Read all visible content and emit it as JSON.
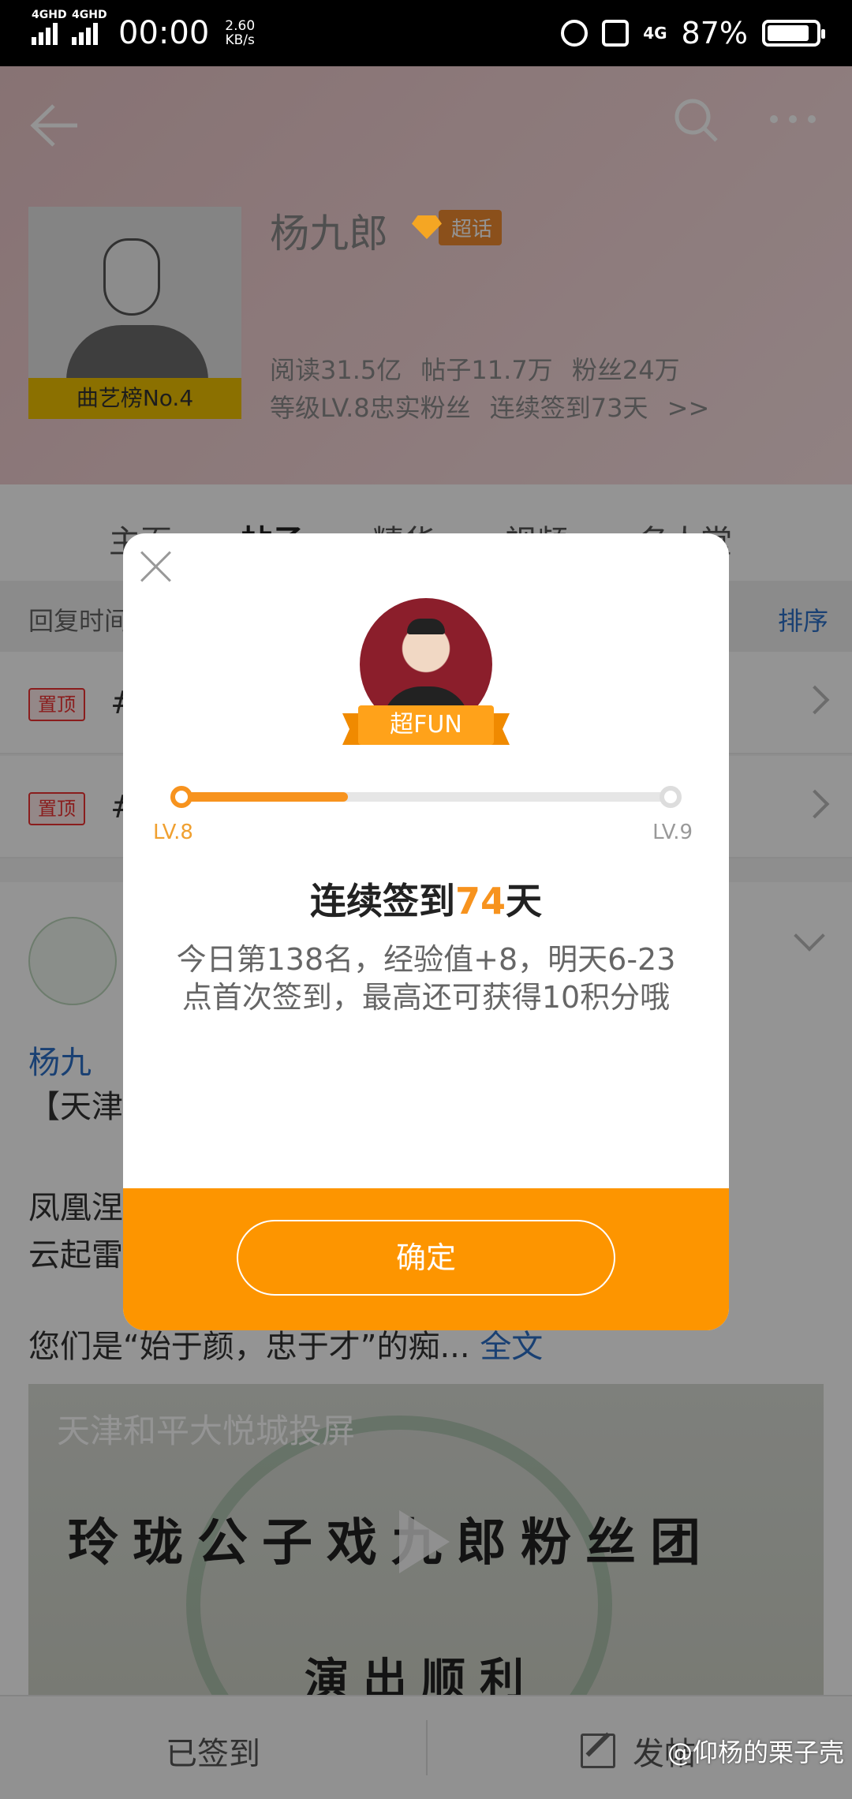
{
  "status_bar": {
    "network1": "4GHD",
    "network2": "4GHD",
    "time": "00:00",
    "speed_value": "2.60",
    "speed_unit": "KB/s",
    "network3": "4G",
    "battery": "87%",
    "battery_level": 0.87
  },
  "header": {
    "topic_name": "杨九郎",
    "badge": "超话",
    "rank_label": "曲艺榜No.4",
    "stats_line1": "阅读31.5亿  帖子11.7万  粉丝24万",
    "stats_line2": "等级LV.8忠实粉丝  连续签到73天 >>"
  },
  "tabs": [
    "主页",
    "帖子",
    "精华",
    "视频",
    "名人堂"
  ],
  "active_tab": 1,
  "sort_bar": {
    "left": "回复时间",
    "right": "排序"
  },
  "pinned": [
    {
      "tag": "置顶",
      "text": "#"
    },
    {
      "tag": "置顶",
      "text": "#"
    }
  ],
  "post": {
    "author": "杨九",
    "line1": "【天津",
    "line2": "凤凰涅",
    "line3": "云起雷",
    "line4": "您们是“始于颜，忠于才”的痴...",
    "more": "全文",
    "video_title": "天津和平大悦城投屏",
    "video_banner": "玲珑公子戏九郎粉丝团",
    "video_banner2": "演出顺利"
  },
  "bottom_bar": {
    "checked_in": "已签到",
    "post": "发帖"
  },
  "watermark": "@仰杨的栗子壳",
  "dialog": {
    "ribbon": "超FUN",
    "level_from": "LV.8",
    "level_to": "LV.9",
    "progress": 0.34,
    "title_prefix": "连续签到",
    "title_days": "74",
    "title_suffix": "天",
    "message": "今日第138名，经验值+8，明天6-23点首次签到，最高还可获得10积分哦",
    "confirm": "确定"
  },
  "colors": {
    "accent": "#fd9500",
    "link": "#2b6fc6"
  }
}
